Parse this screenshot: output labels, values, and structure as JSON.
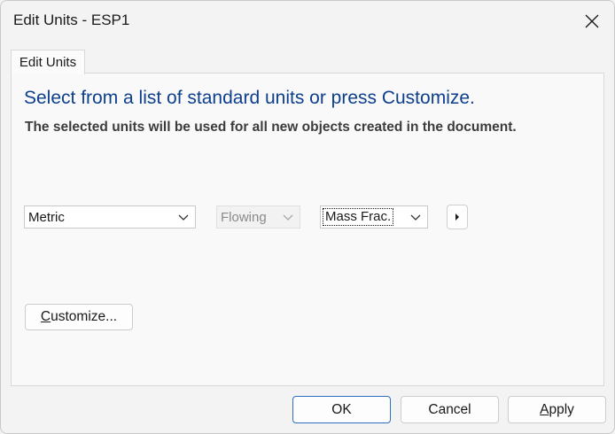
{
  "window": {
    "title": "Edit Units - ESP1"
  },
  "tabs": [
    {
      "label": "Edit Units"
    }
  ],
  "panel": {
    "heading": "Select from a list of standard units or press Customize.",
    "subheading": "The selected units will be used for all new objects created in the document."
  },
  "selects": {
    "unit_set": "Metric",
    "flow_basis": "Flowing",
    "composition": "Mass Frac."
  },
  "buttons": {
    "customize": {
      "access_key": "C",
      "rest": "ustomize..."
    },
    "ok": "OK",
    "cancel": "Cancel",
    "apply": {
      "access_key": "A",
      "rest": "pply"
    }
  },
  "icons": {
    "close": "close-icon",
    "chevron": "chevron-down-icon",
    "arrow": "triangle-right-icon"
  },
  "colors": {
    "heading": "#0d3f8c",
    "default_button_border": "#2f6fc2"
  }
}
